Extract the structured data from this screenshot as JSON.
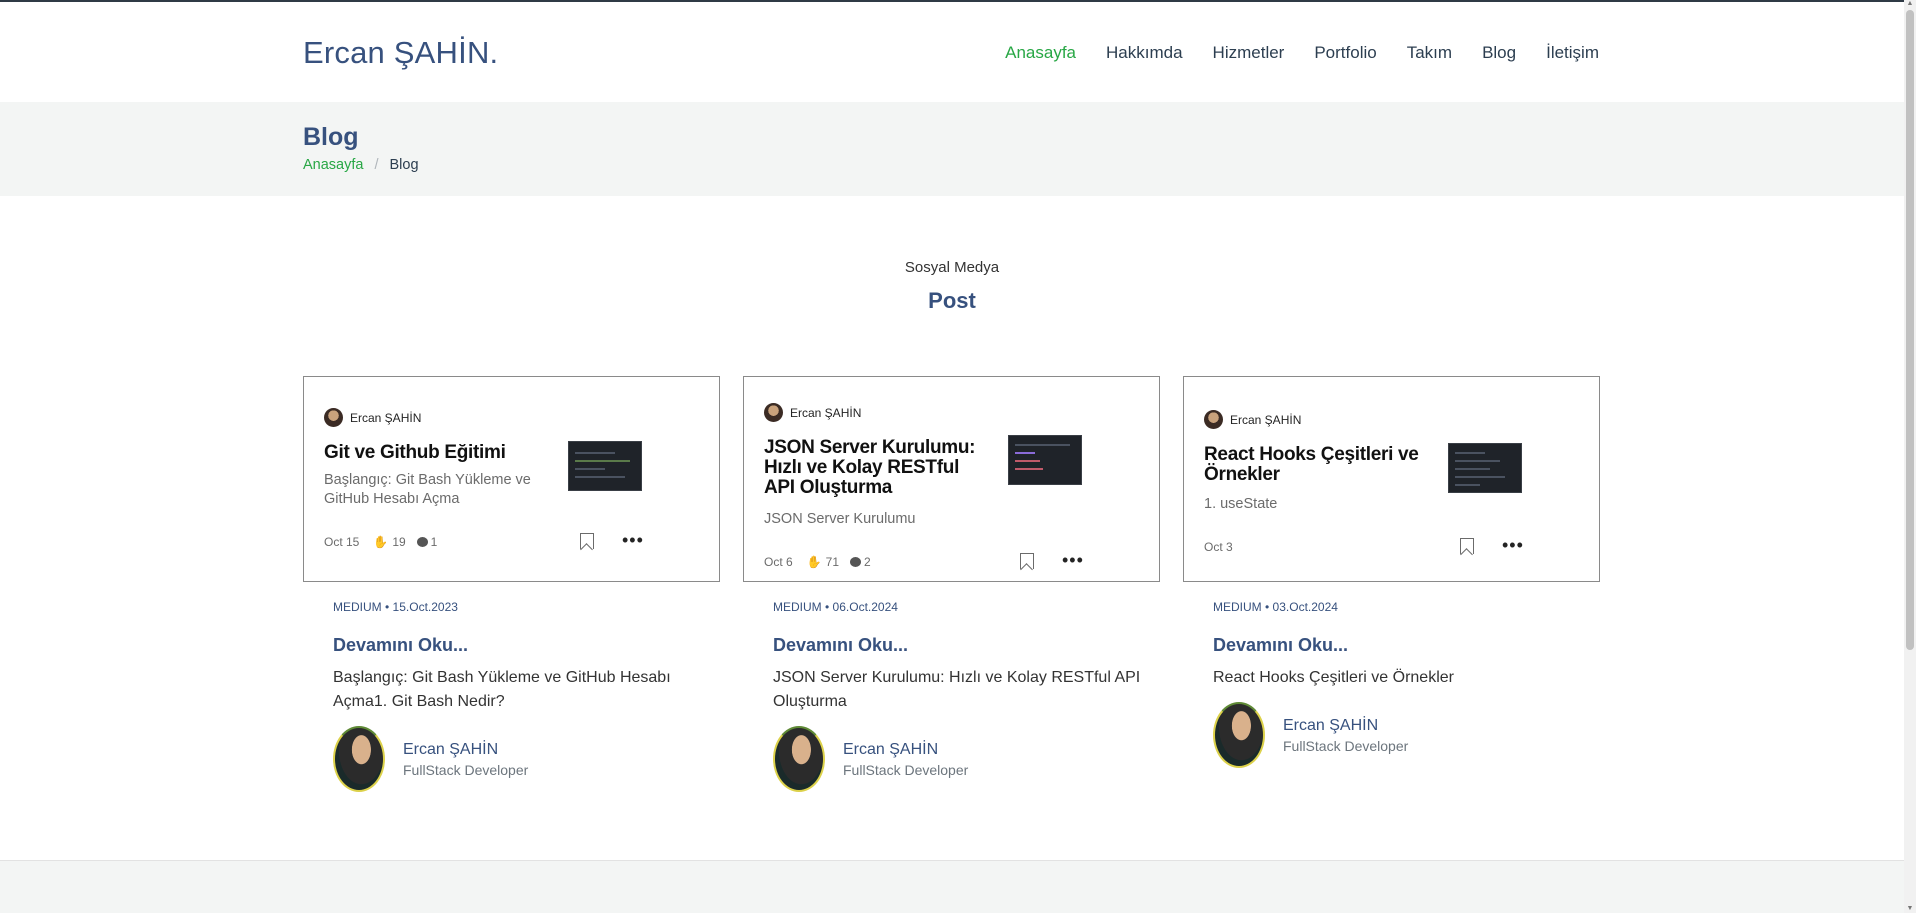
{
  "header": {
    "logo": "Ercan ŞAHİN.",
    "nav": [
      "Anasayfa",
      "Hakkımda",
      "Hizmetler",
      "Portfolio",
      "Takım",
      "Blog",
      "İletişim"
    ]
  },
  "band": {
    "title": "Blog",
    "crumb_home": "Anasayfa",
    "crumb_sep": "/",
    "crumb_current": "Blog"
  },
  "section": {
    "subtitle": "Sosyal Medya",
    "title": "Post"
  },
  "posts": [
    {
      "card_author": "Ercan ŞAHİN",
      "card_title": "Git ve Github Eğitimi",
      "card_subtitle": "Başlangıç: Git Bash Yükleme ve GitHub Hesabı Açma",
      "card_date": "Oct 15",
      "claps": "19",
      "comments": "1",
      "source": "MEDIUM",
      "date": "• 15.Oct.2023",
      "read_more": "Devamını Oku...",
      "description": "Başlangıç: Git Bash Yükleme ve GitHub Hesabı Açma1. Git Bash Nedir?",
      "author_name": "Ercan ŞAHİN",
      "author_role": "FullStack Developer"
    },
    {
      "card_author": "Ercan ŞAHİN",
      "card_title": "JSON Server Kurulumu: Hızlı ve Kolay RESTful API Oluşturma",
      "card_subtitle": "JSON Server Kurulumu",
      "card_date": "Oct 6",
      "claps": "71",
      "comments": "2",
      "source": "MEDIUM",
      "date": "• 06.Oct.2024",
      "read_more": "Devamını Oku...",
      "description": "JSON Server Kurulumu: Hızlı ve Kolay RESTful API Oluşturma",
      "author_name": "Ercan ŞAHİN",
      "author_role": "FullStack Developer"
    },
    {
      "card_author": "Ercan ŞAHİN",
      "card_title": "React Hooks Çeşitleri ve Örnekler",
      "card_subtitle": "1. useState",
      "card_date": "Oct 3",
      "claps": "",
      "comments": "",
      "source": "MEDIUM",
      "date": "• 03.Oct.2024",
      "read_more": "Devamını Oku...",
      "description": "React Hooks Çeşitleri ve Örnekler",
      "author_name": "Ercan ŞAHİN",
      "author_role": "FullStack Developer"
    }
  ],
  "icons": {
    "clap": "clap-icon",
    "comment": "comment-icon",
    "save": "bookmark-icon",
    "more": "more-icon"
  },
  "colors": {
    "brand": "#37517e",
    "active_nav": "#28a745",
    "band_bg": "#f3f5f4"
  }
}
